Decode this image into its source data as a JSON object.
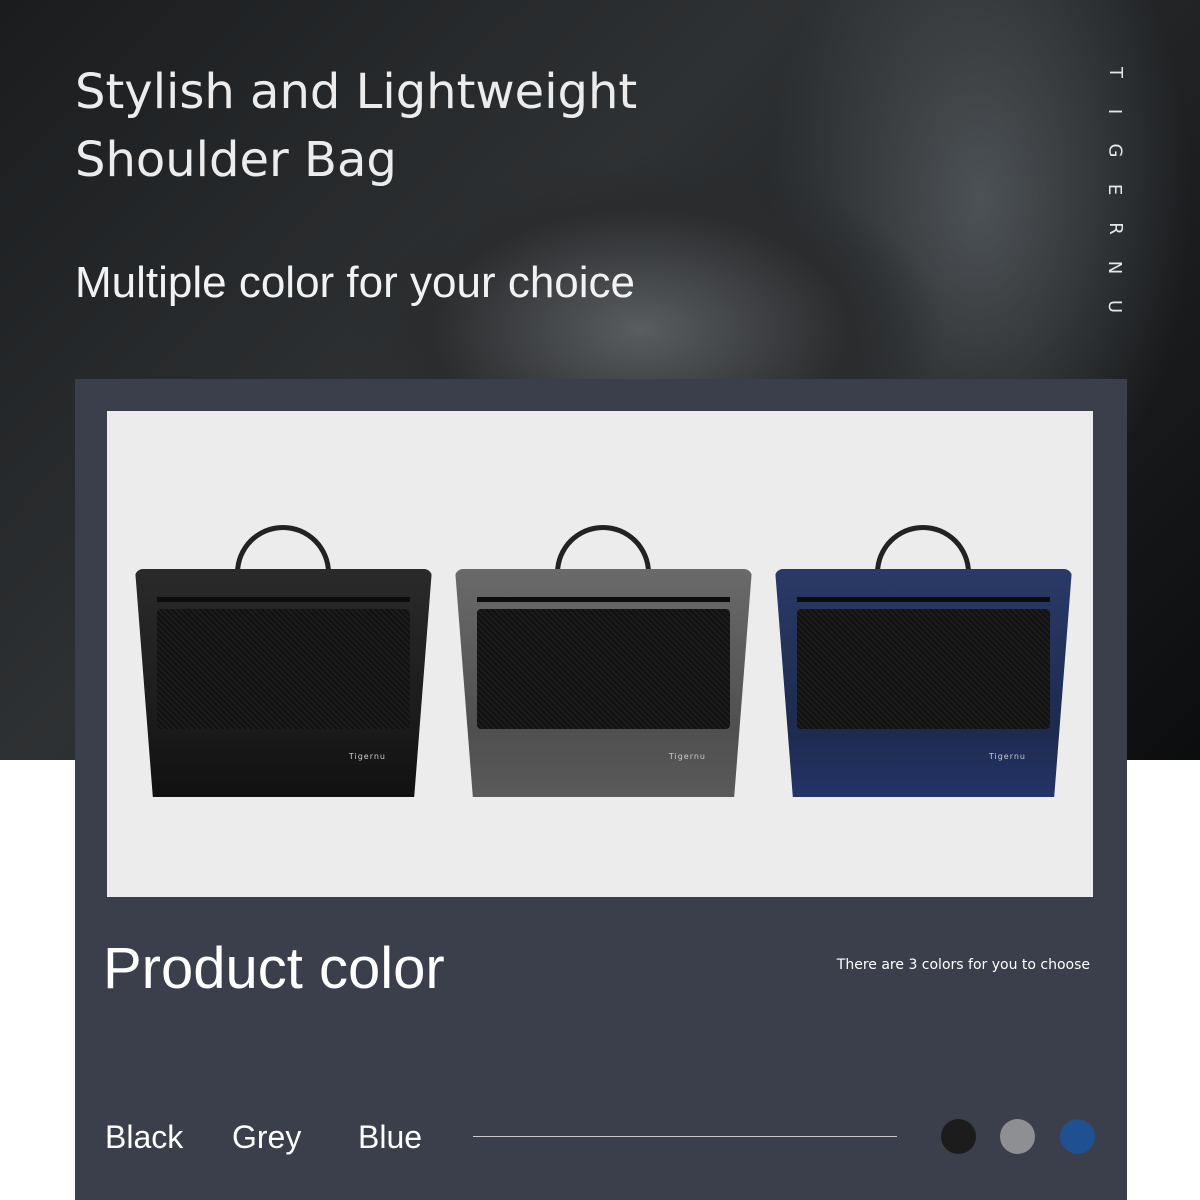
{
  "hero": {
    "title_line1": "Stylish and Lightweight",
    "title_line2": "Shoulder Bag",
    "subtitle": "Multiple color for your choice",
    "brand_vertical": [
      "T",
      "I",
      "G",
      "E",
      "R",
      "N",
      "U"
    ]
  },
  "product": {
    "heading": "Product color",
    "note": "There are 3 colors for you to choose",
    "bag_logo": "Tigernu",
    "colors": [
      {
        "name": "Black",
        "hex": "#1c1c1c"
      },
      {
        "name": "Grey",
        "hex": "#8e8f93"
      },
      {
        "name": "Blue",
        "hex": "#1f5090"
      }
    ]
  }
}
